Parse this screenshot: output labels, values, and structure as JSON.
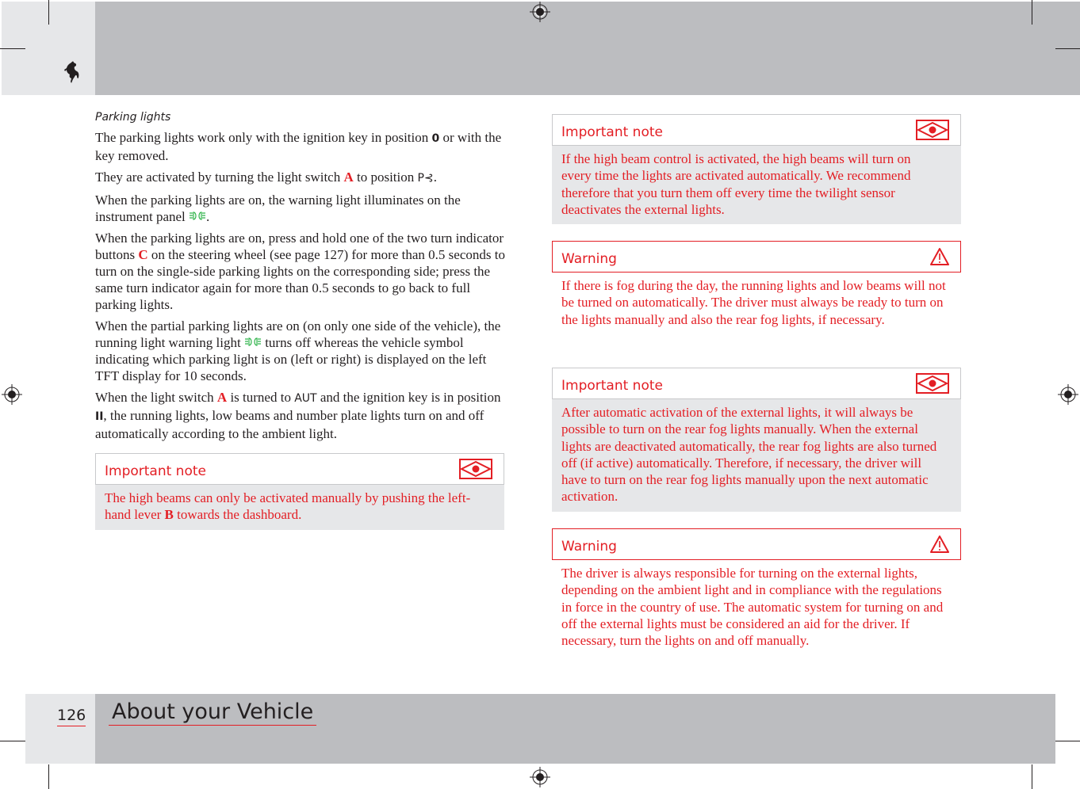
{
  "header": {
    "logo": "prancing-horse-logo"
  },
  "left": {
    "subheading": "Parking lights",
    "paragraphs": {
      "p1_a": "The parking lights work only with the ignition key in position ",
      "p1_key": "0",
      "p1_b": " or with the key removed.",
      "p2_a": "They are activated by turning the light switch ",
      "p2_switch": "A",
      "p2_b": " to position ",
      "p2_symbol": "P⊰",
      "p2_c": ".",
      "p3_a": "When the parking lights are on, the warning light illuminates on the instrument panel ",
      "p3_symbol": "∃D∂∉",
      "p3_b": ".",
      "p4_a": "When the parking lights are on, press and hold one of the two turn indicator buttons ",
      "p4_button": "C",
      "p4_b": " on the steering wheel (see page 127) for more than 0.5 seconds to turn on the single-side parking lights on the corresponding side; press the same turn indicator again for more than 0.5 seconds to go back to full parking lights.",
      "p5_a": "When the partial parking lights are on (on only one side of the vehicle), the running light warning light ",
      "p5_symbol": "∃D∂∉",
      "p5_b": " turns off whereas the vehicle symbol indicating which parking light is on (left or right) is displayed on the left TFT display for 10 seconds.",
      "p6_a": "When the light switch ",
      "p6_switch": "A",
      "p6_b": " is turned to ",
      "p6_aut": "AUT",
      "p6_c": " and the ignition key is in position ",
      "p6_pos": "II",
      "p6_d": ", the running lights, low beams and number plate lights turn on and off automatically according to the ambient light."
    },
    "note": {
      "title": "Important note",
      "icon": "important-note-eye-icon",
      "body_a": "The high beams can only be activated manually by pushing the left-hand lever ",
      "body_lever": "B",
      "body_b": " towards the dashboard."
    }
  },
  "right": {
    "boxes": [
      {
        "type": "note",
        "title": "Important note",
        "icon": "important-note-eye-icon",
        "body": "If the high beam control is activated, the high beams will turn on every time the lights are activated automatically. We recommend therefore that you turn them off every time the twilight sensor deactivates the external lights."
      },
      {
        "type": "warning",
        "title": "Warning",
        "icon": "warning-triangle-icon",
        "body": "If there is fog during the day, the running lights and low beams will not be turned on automatically. The driver must always be ready to turn on the lights manually and also the rear fog lights, if necessary."
      },
      {
        "type": "note",
        "title": "Important note",
        "icon": "important-note-eye-icon",
        "body": "After automatic activation of the external lights, it will always be possible to turn on the rear fog lights manually. When the external lights are deactivated automatically, the rear fog lights are also turned off (if active) automatically. Therefore, if necessary, the driver will have to turn on the rear fog lights manually upon the next automatic activation."
      },
      {
        "type": "warning",
        "title": "Warning",
        "icon": "warning-triangle-icon",
        "body": "The driver is always responsible for turning on the external lights, depending on the ambient light and in compliance with the regulations in force in the country of use. The automatic system for turning on and off the external lights must be considered an aid for the driver. If necessary, turn the lights on and off manually."
      }
    ]
  },
  "footer": {
    "page_number": "126",
    "section_title": "About your Vehicle"
  },
  "colors": {
    "accent_red": "#e31e24",
    "indicator_green": "#2fb34a",
    "band_dark": "#bcbdc0",
    "band_light": "#e6e7e9"
  }
}
